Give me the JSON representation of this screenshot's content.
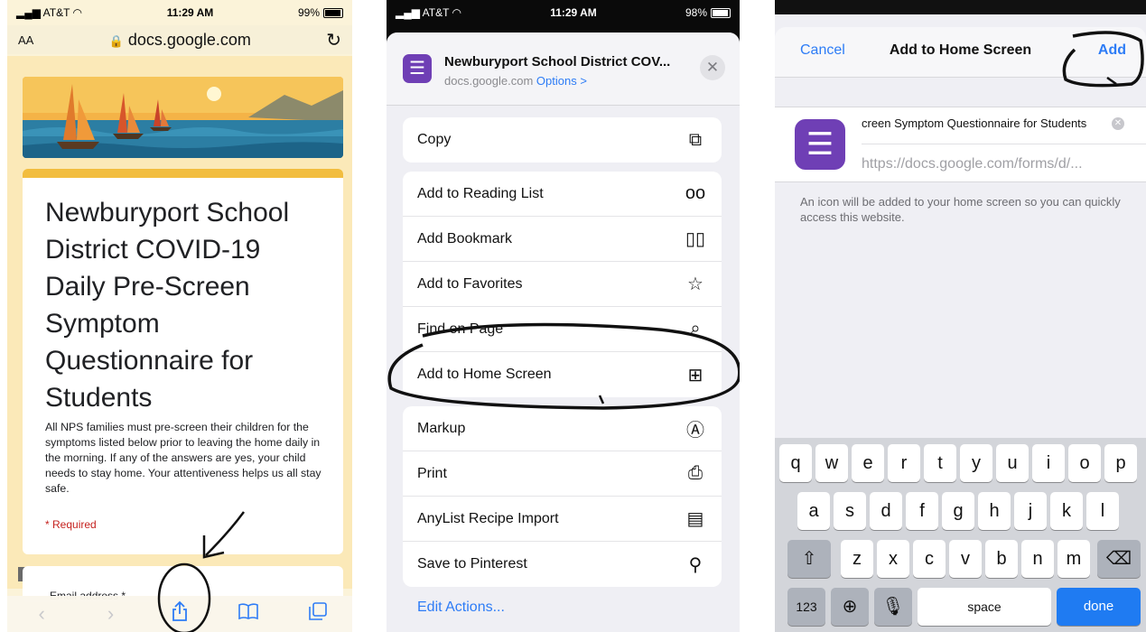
{
  "panel1": {
    "status": {
      "carrier": "AT&T",
      "time": "11:29 AM",
      "battery": "99%"
    },
    "urlbar": {
      "aa": "AA",
      "url": "docs.google.com"
    },
    "form": {
      "title": "Newburyport School District COVID-19 Daily Pre-Screen Symptom Questionnaire for Students",
      "description": "All NPS families must pre-screen their children for the symptoms listed below prior to leaving the home daily in the morning. If any of the answers are yes, your child needs to stay home.   Your attentiveness helps us all stay safe.",
      "required_note": "* Required",
      "email_label": "Email address *"
    },
    "toolbar": [
      "back-icon",
      "forward-icon",
      "share-icon",
      "bookmarks-icon",
      "tabs-icon"
    ]
  },
  "panel2": {
    "status": {
      "carrier": "AT&T",
      "time": "11:29 AM",
      "battery": "98%"
    },
    "header": {
      "title": "Newburyport School District COV...",
      "domain": "docs.google.com",
      "options": "Options >"
    },
    "group1": [
      {
        "label": "Copy",
        "icon": "copy-icon"
      }
    ],
    "group2": [
      {
        "label": "Add to Reading List",
        "icon": "glasses-icon"
      },
      {
        "label": "Add Bookmark",
        "icon": "book-icon"
      },
      {
        "label": "Add to Favorites",
        "icon": "star-icon"
      },
      {
        "label": "Find on Page",
        "icon": "search-icon"
      },
      {
        "label": "Add to Home Screen",
        "icon": "plus-square-icon"
      }
    ],
    "group3": [
      {
        "label": "Markup",
        "icon": "markup-icon"
      },
      {
        "label": "Print",
        "icon": "print-icon"
      },
      {
        "label": "AnyList Recipe Import",
        "icon": "anylist-icon"
      },
      {
        "label": "Save to Pinterest",
        "icon": "pin-icon"
      }
    ],
    "edit_actions": "Edit Actions..."
  },
  "panel3": {
    "nav": {
      "cancel": "Cancel",
      "title": "Add to Home Screen",
      "add": "Add"
    },
    "entry": {
      "name": "creen Symptom Questionnaire for Students",
      "url": "https://docs.google.com/forms/d/..."
    },
    "hint": "An icon will be added to your home screen so you can quickly access this website.",
    "keyboard": {
      "row1": [
        "q",
        "w",
        "e",
        "r",
        "t",
        "y",
        "u",
        "i",
        "o",
        "p"
      ],
      "row2": [
        "a",
        "s",
        "d",
        "f",
        "g",
        "h",
        "j",
        "k",
        "l"
      ],
      "row3": [
        "z",
        "x",
        "c",
        "v",
        "b",
        "n",
        "m"
      ],
      "numbers": "123",
      "space": "space",
      "done": "done"
    }
  },
  "colors": {
    "ios_blue": "#2d7cf6",
    "forms_purple": "#6f3fb5",
    "forms_yellow": "#f2bd3e",
    "required_red": "#c5221f"
  }
}
